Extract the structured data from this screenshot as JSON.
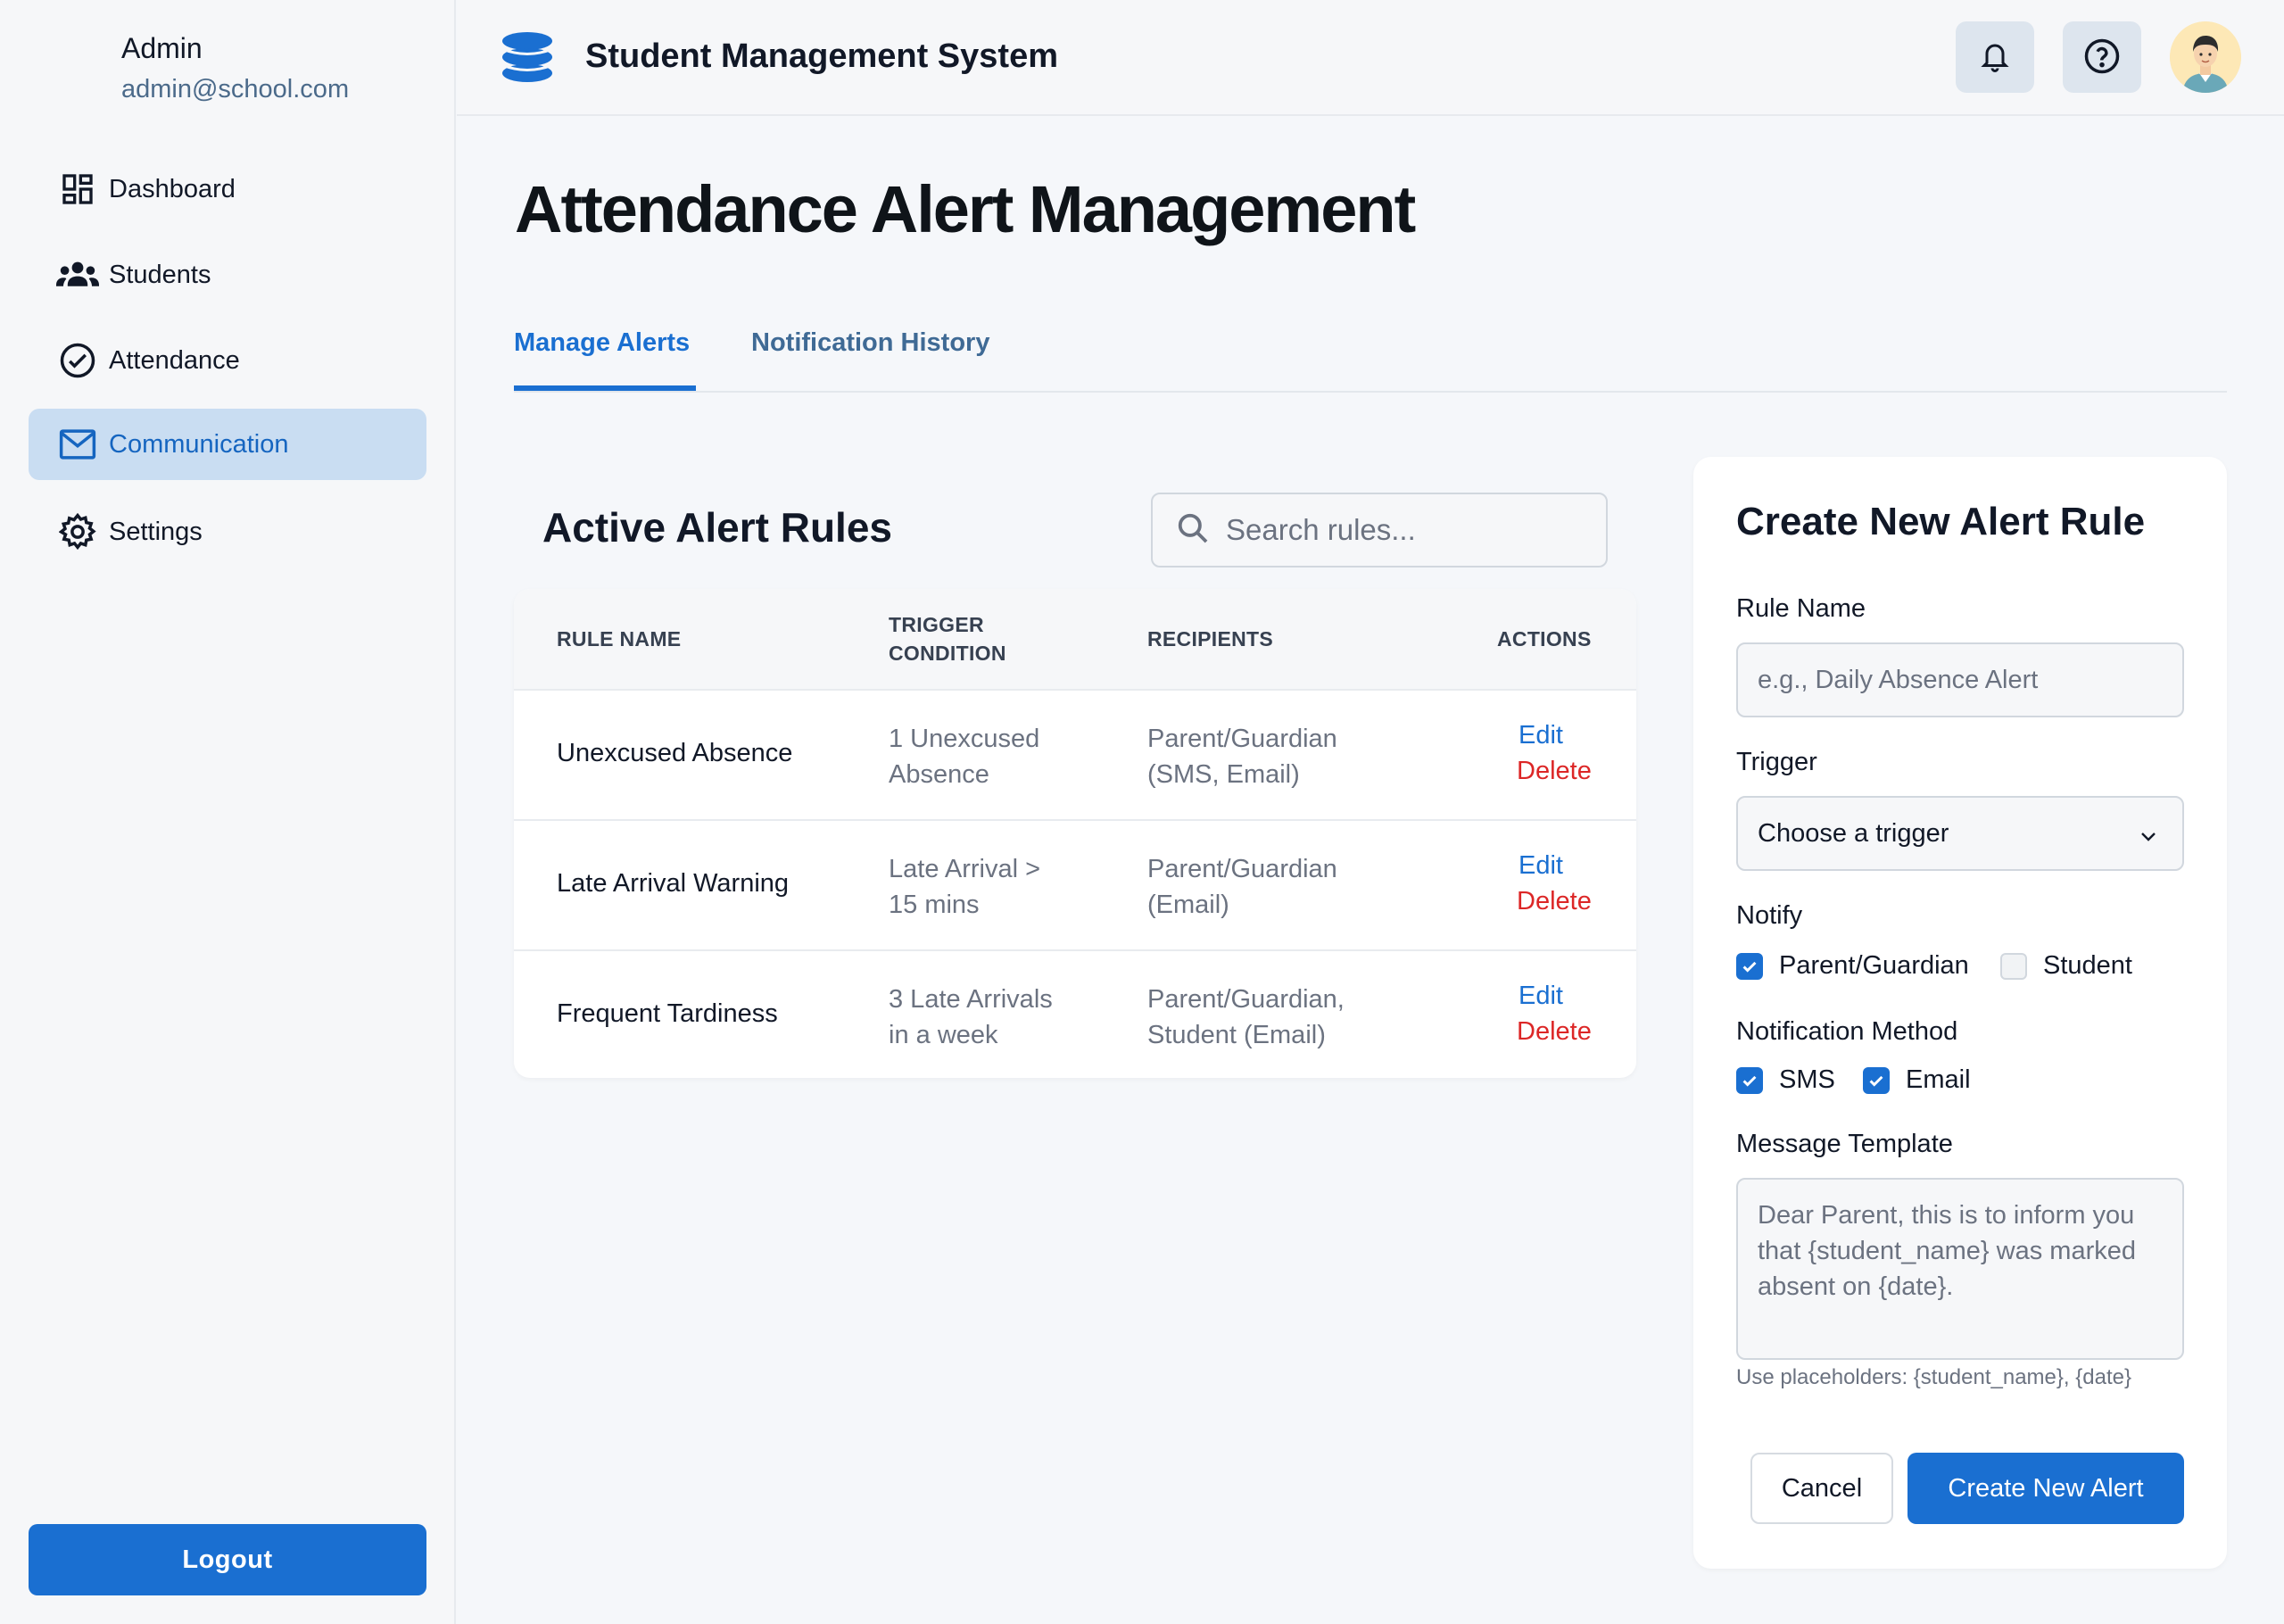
{
  "sidebar": {
    "user_name": "Admin",
    "user_email": "admin@school.com",
    "items": [
      {
        "label": "Dashboard",
        "icon": "dashboard-icon"
      },
      {
        "label": "Students",
        "icon": "users-icon"
      },
      {
        "label": "Attendance",
        "icon": "check-circle-icon"
      },
      {
        "label": "Communication",
        "icon": "mail-icon",
        "active": true
      },
      {
        "label": "Settings",
        "icon": "gear-icon"
      }
    ],
    "logout_label": "Logout"
  },
  "header": {
    "app_title": "Student Management System",
    "icons": [
      "database-logo-icon",
      "bell-icon",
      "help-icon",
      "avatar"
    ]
  },
  "main": {
    "page_title": "Attendance Alert Management",
    "tabs": [
      {
        "label": "Manage Alerts",
        "active": true
      },
      {
        "label": "Notification History",
        "active": false
      }
    ],
    "section_title": "Active Alert Rules",
    "search_placeholder": "Search rules...",
    "table": {
      "headers": [
        "RULE NAME",
        "TRIGGER",
        "CONDITION",
        "RECIPIENTS",
        "ACTIONS"
      ],
      "rows": [
        {
          "name": "Unexcused Absence",
          "trigger_1": "1 Unexcused",
          "trigger_2": "Absence",
          "recipients_1": "Parent/Guardian",
          "recipients_2": "(SMS, Email)",
          "edit": "Edit",
          "delete": "Delete"
        },
        {
          "name": "Late Arrival Warning",
          "trigger_1": "Late Arrival >",
          "trigger_2": "15 mins",
          "recipients_1": "Parent/Guardian",
          "recipients_2": "(Email)",
          "edit": "Edit",
          "delete": "Delete"
        },
        {
          "name": "Frequent Tardiness",
          "trigger_1": "3 Late Arrivals",
          "trigger_2": "in a week",
          "recipients_1": "Parent/Guardian,",
          "recipients_2": "Student (Email)",
          "edit": "Edit",
          "delete": "Delete"
        }
      ]
    }
  },
  "form": {
    "title": "Create New Alert Rule",
    "rule_name_label": "Rule Name",
    "rule_name_placeholder": "e.g., Daily Absence Alert",
    "trigger_label": "Trigger",
    "trigger_value": "Choose a trigger",
    "notify_label": "Notify",
    "notify_options": [
      {
        "label": "Parent/Guardian",
        "checked": true
      },
      {
        "label": "Student",
        "checked": false
      }
    ],
    "method_label": "Notification Method",
    "method_options": [
      {
        "label": "SMS",
        "checked": true
      },
      {
        "label": "Email",
        "checked": true
      }
    ],
    "template_label": "Message Template",
    "template_value_1": "Dear Parent, this is to inform you",
    "template_value_2": "that {student_name} was marked",
    "template_value_3": "absent on {date}.",
    "hint": "Use placeholders: {student_name}, {date}",
    "cancel_label": "Cancel",
    "create_label": "Create New Alert"
  },
  "colors": {
    "accent": "#1a6fd1",
    "danger": "#dc2626",
    "active_nav_bg": "#c9ddf2"
  }
}
